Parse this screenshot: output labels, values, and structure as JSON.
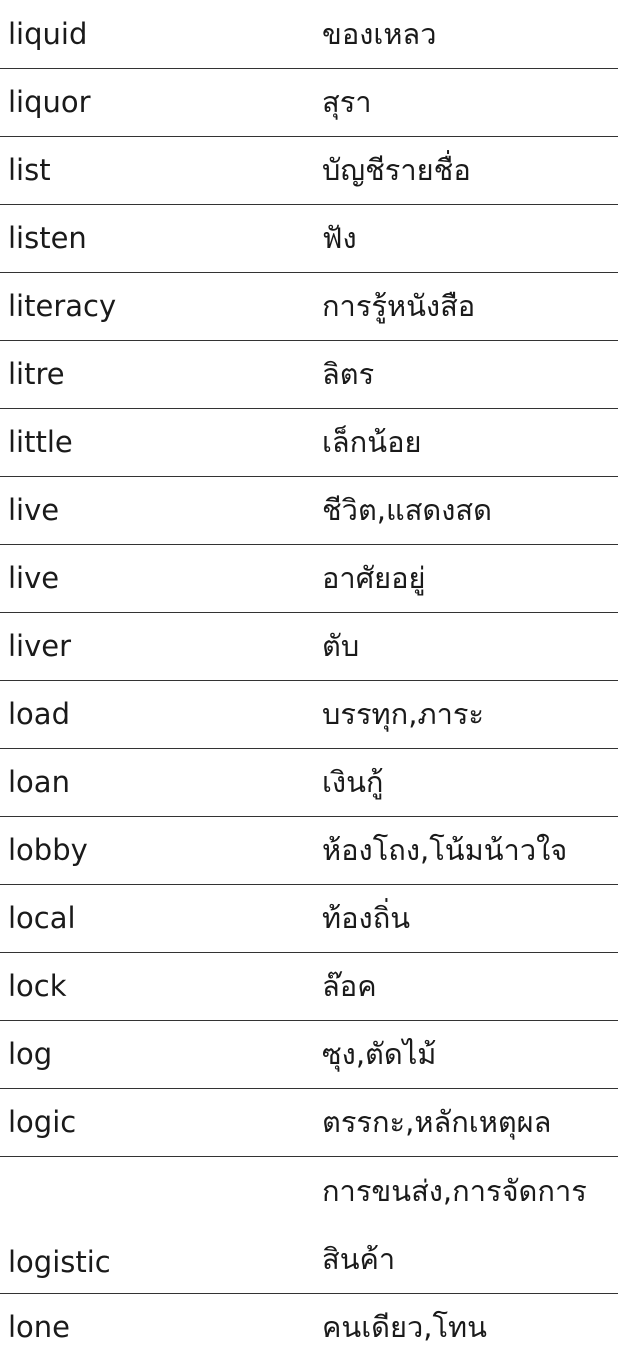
{
  "entries": [
    {
      "en": "liquid",
      "th": "ของเหลว"
    },
    {
      "en": "liquor",
      "th": "สุรา"
    },
    {
      "en": "list",
      "th": "บัญชีรายชื่อ"
    },
    {
      "en": "listen",
      "th": "ฟัง"
    },
    {
      "en": "literacy",
      "th": "การรู้หนังสือ"
    },
    {
      "en": "litre",
      "th": "ลิตร"
    },
    {
      "en": "little",
      "th": "เล็กน้อย"
    },
    {
      "en": "live",
      "th": "ชีวิต,แสดงสด"
    },
    {
      "en": "live",
      "th": "อาศัยอยู่"
    },
    {
      "en": "liver",
      "th": "ตับ"
    },
    {
      "en": "load",
      "th": "บรรทุก,ภาระ"
    },
    {
      "en": "loan",
      "th": "เงินกู้"
    },
    {
      "en": "lobby",
      "th": "ห้องโถง,โน้มน้าวใจ"
    },
    {
      "en": "local",
      "th": "ท้องถิ่น"
    },
    {
      "en": "lock",
      "th": "ล๊อค"
    },
    {
      "en": "log",
      "th": "ซุง,ตัดไม้"
    },
    {
      "en": "logic",
      "th": "ตรรกะ,หลักเหตุผล"
    },
    {
      "en": "logistic",
      "th": "การขนส่ง,การจัดการสินค้า"
    },
    {
      "en": "lone",
      "th": "คนเดียว,โทน"
    }
  ]
}
